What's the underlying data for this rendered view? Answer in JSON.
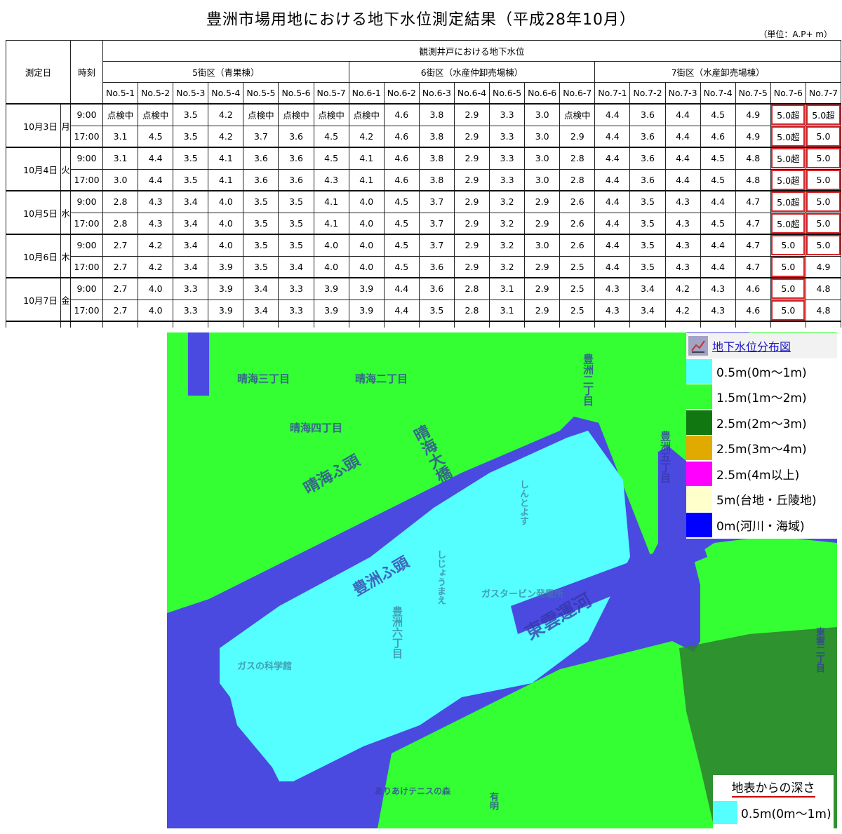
{
  "title": "豊洲市場用地における地下水位測定結果（平成28年10月）",
  "unit": "（単位：A.P+ m）",
  "table": {
    "col_date": "測定日",
    "col_time": "時刻",
    "group_header": "観測井戸における地下水位",
    "zones": [
      {
        "label": "5街区（青果棟）"
      },
      {
        "label": "6街区（水産仲卸売場棟）"
      },
      {
        "label": "7街区（水産卸売場棟）"
      }
    ],
    "wells": [
      "No.5-1",
      "No.5-2",
      "No.5-3",
      "No.5-4",
      "No.5-5",
      "No.5-6",
      "No.5-7",
      "No.6-1",
      "No.6-2",
      "No.6-3",
      "No.6-4",
      "No.6-5",
      "No.6-6",
      "No.6-7",
      "No.7-1",
      "No.7-2",
      "No.7-3",
      "No.7-4",
      "No.7-5",
      "No.7-6",
      "No.7-7"
    ],
    "days": [
      {
        "date": "10月3日",
        "weekday": "月",
        "rows": [
          {
            "time": "9:00",
            "values": [
              "点検中",
              "点検中",
              "3.5",
              "4.2",
              "点検中",
              "点検中",
              "点検中",
              "点検中",
              "4.6",
              "3.8",
              "2.9",
              "3.3",
              "3.0",
              "点検中",
              "4.4",
              "3.6",
              "4.4",
              "4.5",
              "4.9",
              "5.0超",
              "5.0超"
            ]
          },
          {
            "time": "17:00",
            "values": [
              "3.1",
              "4.5",
              "3.5",
              "4.2",
              "3.7",
              "3.6",
              "4.5",
              "4.2",
              "4.6",
              "3.8",
              "2.9",
              "3.3",
              "3.0",
              "2.9",
              "4.4",
              "3.6",
              "4.4",
              "4.6",
              "4.9",
              "5.0超",
              "5.0"
            ]
          }
        ]
      },
      {
        "date": "10月4日",
        "weekday": "火",
        "rows": [
          {
            "time": "9:00",
            "values": [
              "3.1",
              "4.4",
              "3.5",
              "4.1",
              "3.6",
              "3.6",
              "4.5",
              "4.1",
              "4.6",
              "3.8",
              "2.9",
              "3.3",
              "3.0",
              "2.8",
              "4.4",
              "3.6",
              "4.4",
              "4.5",
              "4.8",
              "5.0超",
              "5.0"
            ]
          },
          {
            "time": "17:00",
            "values": [
              "3.0",
              "4.4",
              "3.5",
              "4.1",
              "3.6",
              "3.6",
              "4.3",
              "4.1",
              "4.6",
              "3.8",
              "2.9",
              "3.3",
              "3.0",
              "2.8",
              "4.4",
              "3.6",
              "4.4",
              "4.5",
              "4.8",
              "5.0超",
              "5.0"
            ]
          }
        ]
      },
      {
        "date": "10月5日",
        "weekday": "水",
        "rows": [
          {
            "time": "9:00",
            "values": [
              "2.8",
              "4.3",
              "3.4",
              "4.0",
              "3.5",
              "3.5",
              "4.1",
              "4.0",
              "4.5",
              "3.7",
              "2.9",
              "3.2",
              "2.9",
              "2.6",
              "4.4",
              "3.5",
              "4.3",
              "4.4",
              "4.7",
              "5.0超",
              "5.0"
            ]
          },
          {
            "time": "17:00",
            "values": [
              "2.8",
              "4.3",
              "3.4",
              "4.0",
              "3.5",
              "3.5",
              "4.1",
              "4.0",
              "4.5",
              "3.7",
              "2.9",
              "3.2",
              "2.9",
              "2.6",
              "4.4",
              "3.5",
              "4.3",
              "4.5",
              "4.7",
              "5.0超",
              "5.0"
            ]
          }
        ]
      },
      {
        "date": "10月6日",
        "weekday": "木",
        "rows": [
          {
            "time": "9:00",
            "values": [
              "2.7",
              "4.2",
              "3.4",
              "4.0",
              "3.5",
              "3.5",
              "4.0",
              "4.0",
              "4.5",
              "3.7",
              "2.9",
              "3.2",
              "3.0",
              "2.6",
              "4.4",
              "3.5",
              "4.3",
              "4.4",
              "4.7",
              "5.0",
              "5.0"
            ]
          },
          {
            "time": "17:00",
            "values": [
              "2.7",
              "4.2",
              "3.4",
              "3.9",
              "3.5",
              "3.4",
              "4.0",
              "4.0",
              "4.5",
              "3.6",
              "2.9",
              "3.2",
              "2.9",
              "2.5",
              "4.4",
              "3.5",
              "4.3",
              "4.4",
              "4.7",
              "5.0",
              "4.9"
            ]
          }
        ]
      },
      {
        "date": "10月7日",
        "weekday": "金",
        "rows": [
          {
            "time": "9:00",
            "values": [
              "2.7",
              "4.0",
              "3.3",
              "3.9",
              "3.4",
              "3.3",
              "3.9",
              "3.9",
              "4.4",
              "3.6",
              "2.8",
              "3.1",
              "2.9",
              "2.5",
              "4.3",
              "3.4",
              "4.2",
              "4.3",
              "4.6",
              "5.0",
              "4.8"
            ]
          },
          {
            "time": "17:00",
            "values": [
              "2.7",
              "4.0",
              "3.3",
              "3.9",
              "3.4",
              "3.3",
              "3.9",
              "3.9",
              "4.4",
              "3.5",
              "2.8",
              "3.1",
              "2.9",
              "2.5",
              "4.3",
              "3.4",
              "4.2",
              "4.3",
              "4.6",
              "5.0",
              "4.8"
            ]
          }
        ]
      }
    ]
  },
  "map": {
    "colors": {
      "river": "#4a4ae0",
      "low": "#55ffff",
      "mid": "#33ff33",
      "deep": "#2e8b2e"
    },
    "labels": {
      "harumi3": "晴海三丁目",
      "harumi2": "晴海二丁目",
      "harumi4": "晴海四丁目",
      "harumi_futo": "晴海ふ頭",
      "harumi_ohashi": "晴海大橋",
      "toyosu_futo": "豊洲ふ頭",
      "toyosu2": "豊洲二丁目",
      "toyosu5": "豊洲五丁目",
      "toyosu6": "豊洲六丁目",
      "shintoyosu": "しんとよす",
      "shijoumae": "しじょうまえ",
      "gas_turbine": "ガスタービン発電所",
      "gas_science": "ガスの科学館",
      "shinonome_canal": "東雲運河",
      "shinonome2": "東雲二丁目",
      "ariake_tennis": "ありあけテニスの森",
      "ariake": "有明"
    }
  },
  "legend": {
    "title": "地下水位分布図",
    "items": [
      {
        "color": "#55ffff",
        "label": "0.5m(0m～1m)"
      },
      {
        "color": "#33ff33",
        "label": "1.5m(1m～2m)"
      },
      {
        "color": "#117711",
        "label": "2.5m(2m～3m)"
      },
      {
        "color": "#e0aa00",
        "label": "2.5m(3m～4m)"
      },
      {
        "color": "#ff00ff",
        "label": "2.5m(4m以上)"
      },
      {
        "color": "#ffffcc",
        "label": "5m(台地・丘陵地)"
      },
      {
        "color": "#0000ff",
        "label": "0m(河川・海域)"
      }
    ]
  },
  "legend2": {
    "heading": "地表からの深さ",
    "color": "#55ffff",
    "label": "0.5m(0m～1m)"
  }
}
